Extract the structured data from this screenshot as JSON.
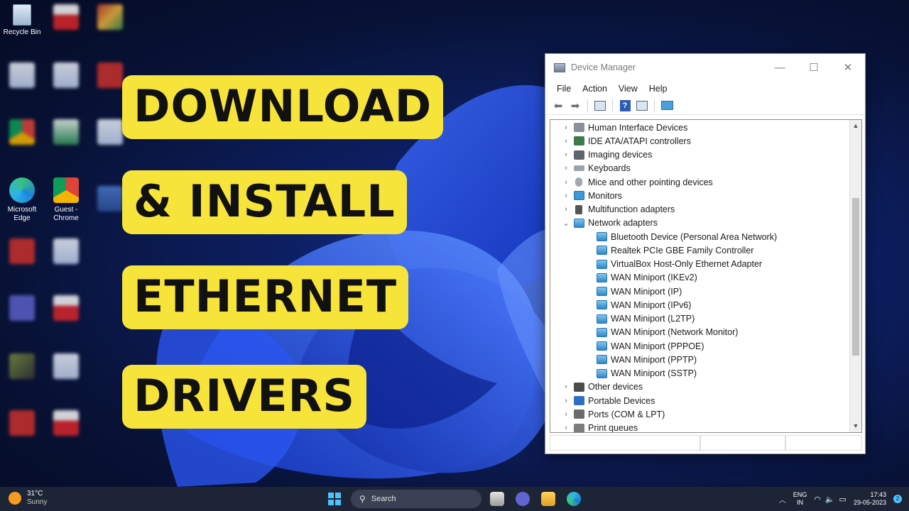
{
  "thumbnail_title": {
    "lines": [
      "DOWNLOAD",
      "& INSTALL",
      "ETHERNET",
      "DRIVERS"
    ],
    "highlight_color": "#f7e43b",
    "text_color": "#111111"
  },
  "desktop": {
    "icons": [
      {
        "label": "Recycle Bin",
        "icon": "recycle-bin-icon"
      },
      {
        "label": "Microsoft Edge",
        "icon": "edge-icon"
      },
      {
        "label": "Guest - Chrome",
        "icon": "chrome-icon"
      }
    ]
  },
  "device_manager": {
    "title": "Device Manager",
    "window_controls": {
      "minimize": "—",
      "maximize": "☐",
      "close": "✕"
    },
    "menu": [
      "File",
      "Action",
      "View",
      "Help"
    ],
    "tree": [
      {
        "label": "Human Interface Devices",
        "icon": "hid-icon",
        "expanded": false,
        "level": 0
      },
      {
        "label": "IDE ATA/ATAPI controllers",
        "icon": "ide-icon",
        "expanded": false,
        "level": 0
      },
      {
        "label": "Imaging devices",
        "icon": "camera-icon",
        "expanded": false,
        "level": 0
      },
      {
        "label": "Keyboards",
        "icon": "keyboard-icon",
        "expanded": false,
        "level": 0
      },
      {
        "label": "Mice and other pointing devices",
        "icon": "mouse-icon",
        "expanded": false,
        "level": 0
      },
      {
        "label": "Monitors",
        "icon": "monitor-icon",
        "expanded": false,
        "level": 0
      },
      {
        "label": "Multifunction adapters",
        "icon": "multifunction-icon",
        "expanded": false,
        "level": 0
      },
      {
        "label": "Network adapters",
        "icon": "network-adapter-icon",
        "expanded": true,
        "level": 0
      },
      {
        "label": "Bluetooth Device (Personal Area Network)",
        "icon": "network-adapter-icon",
        "level": 1
      },
      {
        "label": "Realtek PCIe GBE Family Controller",
        "icon": "network-adapter-icon",
        "level": 1
      },
      {
        "label": "VirtualBox Host-Only Ethernet Adapter",
        "icon": "network-adapter-icon",
        "level": 1
      },
      {
        "label": "WAN Miniport (IKEv2)",
        "icon": "network-adapter-icon",
        "level": 1
      },
      {
        "label": "WAN Miniport (IP)",
        "icon": "network-adapter-icon",
        "level": 1
      },
      {
        "label": "WAN Miniport (IPv6)",
        "icon": "network-adapter-icon",
        "level": 1
      },
      {
        "label": "WAN Miniport (L2TP)",
        "icon": "network-adapter-icon",
        "level": 1
      },
      {
        "label": "WAN Miniport (Network Monitor)",
        "icon": "network-adapter-icon",
        "level": 1
      },
      {
        "label": "WAN Miniport (PPPOE)",
        "icon": "network-adapter-icon",
        "level": 1
      },
      {
        "label": "WAN Miniport (PPTP)",
        "icon": "network-adapter-icon",
        "level": 1
      },
      {
        "label": "WAN Miniport (SSTP)",
        "icon": "network-adapter-icon",
        "level": 1
      },
      {
        "label": "Other devices",
        "icon": "other-devices-icon",
        "expanded": false,
        "level": 0
      },
      {
        "label": "Portable Devices",
        "icon": "portable-device-icon",
        "expanded": false,
        "level": 0
      },
      {
        "label": "Ports (COM & LPT)",
        "icon": "port-icon",
        "expanded": false,
        "level": 0
      },
      {
        "label": "Print queues",
        "icon": "printer-icon",
        "expanded": false,
        "level": 0
      }
    ]
  },
  "taskbar": {
    "weather_temp": "31°C",
    "weather_desc": "Sunny",
    "search_label": "Search",
    "language_line1": "ENG",
    "language_line2": "IN",
    "time": "17:43",
    "date": "29-05-2023",
    "notification_count": "2"
  }
}
